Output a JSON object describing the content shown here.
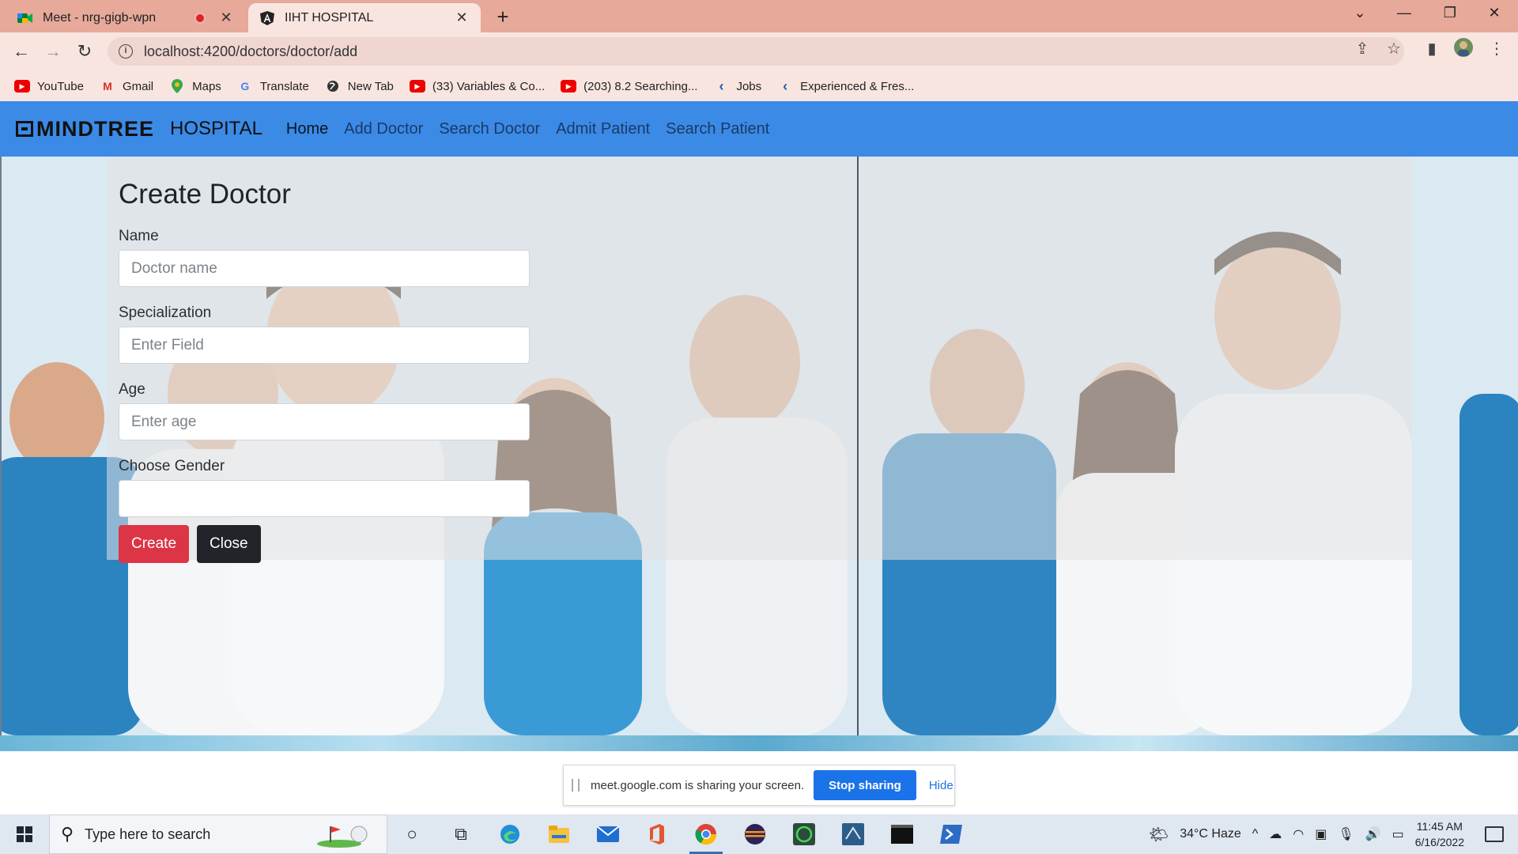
{
  "browser": {
    "tabs": [
      {
        "title": "Meet - nrg-gigb-wpn",
        "recording": true,
        "active": false
      },
      {
        "title": "IIHT HOSPITAL",
        "active": true
      }
    ],
    "new_tab": "+",
    "window_controls": {
      "minimize": "—",
      "maximize": "❐",
      "close": "✕",
      "tab_search": "⌄"
    },
    "url": "localhost:4200/doctors/doctor/add",
    "bookmarks": [
      {
        "label": "YouTube",
        "icon": "youtube-icon"
      },
      {
        "label": "Gmail",
        "icon": "gmail-icon"
      },
      {
        "label": "Maps",
        "icon": "maps-icon"
      },
      {
        "label": "Translate",
        "icon": "translate-icon"
      },
      {
        "label": "New Tab",
        "icon": "globe-icon"
      },
      {
        "label": "(33) Variables & Co...",
        "icon": "youtube-icon"
      },
      {
        "label": "(203) 8.2 Searching...",
        "icon": "youtube-icon"
      },
      {
        "label": "Jobs",
        "icon": "bookmark-c-icon"
      },
      {
        "label": "Experienced & Fres...",
        "icon": "bookmark-c-icon"
      }
    ]
  },
  "app": {
    "brand_logo": "MINDTREE",
    "brand_text": "HOSPITAL",
    "nav": [
      {
        "label": "Home",
        "active": true
      },
      {
        "label": "Add Doctor",
        "active": false
      },
      {
        "label": "Search Doctor",
        "active": false
      },
      {
        "label": "Admit Patient",
        "active": false
      },
      {
        "label": "Search Patient",
        "active": false
      }
    ],
    "accent_color": "#3b8ae6"
  },
  "form": {
    "title": "Create Doctor",
    "fields": [
      {
        "label": "Name",
        "placeholder": "Doctor name",
        "value": ""
      },
      {
        "label": "Specialization",
        "placeholder": "Enter Field",
        "value": ""
      },
      {
        "label": "Age",
        "placeholder": "Enter age",
        "value": ""
      },
      {
        "label": "Choose Gender",
        "placeholder": "",
        "value": ""
      }
    ],
    "create_label": "Create",
    "close_label": "Close",
    "create_color": "#dc3545",
    "close_color": "#212529"
  },
  "sharing": {
    "message": "meet.google.com is sharing your screen.",
    "stop_label": "Stop sharing",
    "hide_label": "Hide"
  },
  "taskbar": {
    "search_placeholder": "Type here to search",
    "apps": [
      "cortana-icon",
      "task-view-icon",
      "edge-icon",
      "file-explorer-icon",
      "mail-icon",
      "office-icon",
      "chrome-icon",
      "eclipse-icon",
      "whatsapp-icon",
      "sql-icon",
      "terminal-icon",
      "powershell-icon"
    ],
    "weather": "34°C  Haze",
    "time": "11:45 AM",
    "date": "6/16/2022"
  }
}
